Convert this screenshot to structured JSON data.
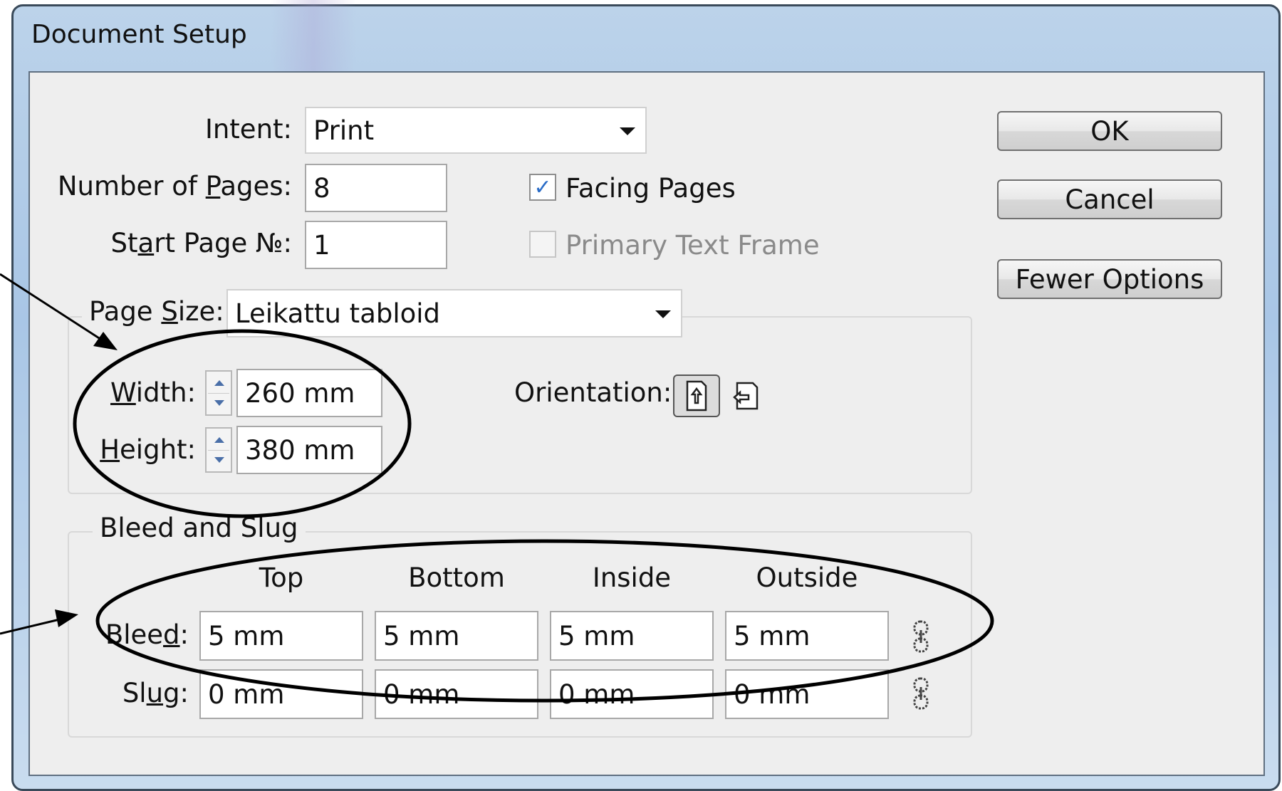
{
  "window": {
    "title": "Document Setup"
  },
  "intent": {
    "label": "Intent:",
    "value": "Print"
  },
  "pages": {
    "label": "Number of Pages:",
    "value": "8"
  },
  "start_page": {
    "label": "Start Page №:",
    "value": "1"
  },
  "facing_pages": {
    "label": "Facing Pages",
    "checked": true
  },
  "primary_text_frame": {
    "label": "Primary Text Frame",
    "checked": false,
    "disabled": true
  },
  "page_size": {
    "label": "Page Size:",
    "value": "Leikattu tabloid"
  },
  "width": {
    "label": "Width:",
    "value": "260 mm"
  },
  "height": {
    "label": "Height:",
    "value": "380 mm"
  },
  "orientation": {
    "label": "Orientation:",
    "options": [
      "portrait-icon",
      "landscape-icon"
    ],
    "selected": "portrait"
  },
  "bleed_slug": {
    "title": "Bleed and Slug",
    "columns": [
      "Top",
      "Bottom",
      "Inside",
      "Outside"
    ],
    "bleed_label": "Bleed:",
    "bleed": [
      "5 mm",
      "5 mm",
      "5 mm",
      "5 mm"
    ],
    "slug_label": "Slug:",
    "slug": [
      "0 mm",
      "0 mm",
      "0 mm",
      "0 mm"
    ]
  },
  "buttons": {
    "ok": "OK",
    "cancel": "Cancel",
    "options": "Fewer Options"
  },
  "colors": {
    "window_frame": "#a9c6e6",
    "client_bg": "#eeeeee",
    "check_accent": "#2a6cc7"
  }
}
